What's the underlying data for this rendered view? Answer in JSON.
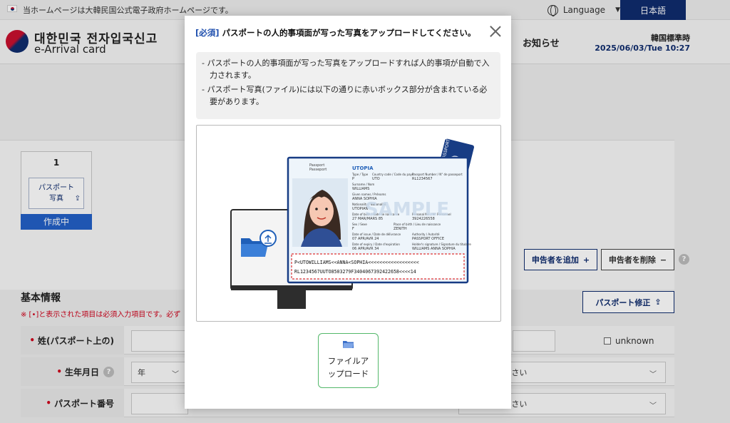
{
  "topbar": {
    "gov_notice": "当ホームページは大韓民国公式電子政府ホームページです。",
    "language_label": "Language",
    "current_language": "日本語"
  },
  "header": {
    "logo_korean": "대한민국 전자입국신고",
    "logo_english": "e-Arrival card",
    "nav_notice": "お知らせ",
    "time_label": "韓国標準時",
    "time_value": "2025/06/03/Tue 10:27"
  },
  "steps": [
    {
      "number": "1",
      "title_line1": "パスポート",
      "title_line2": "写真",
      "status": "作成中"
    }
  ],
  "actions": {
    "add_applicant": "申告者を追加",
    "add_symbol": "+",
    "remove_applicant": "申告者を削除",
    "remove_symbol": "−",
    "passport_edit": "パスポート修正",
    "help_symbol": "?"
  },
  "basic_info": {
    "title": "基本情報",
    "required_note": "※ [•]と表示された項目は必須入力項目です。必ず"
  },
  "form": {
    "star": "•",
    "surname_label": "姓(パスポート上の)",
    "unknown_label": "unknown",
    "birthdate_label": "生年月日",
    "year_placeholder": "年",
    "select_placeholder_1": "選択してください",
    "passport_number_label": "パスポート番号",
    "select_placeholder_2": "選択してください"
  },
  "modal": {
    "title_tag": "[必須]",
    "title_text": " パスポートの人的事項面が写った写真をアップロードしてください。",
    "notice_lines": [
      "- パスポートの人的事項面が写った写真をアップロードすれば人的事項が自動で入力されます。",
      "- パスポート写真(ファイル)には以下の通りに赤いボックス部分が含まれている必要があります。"
    ],
    "upload_label_line1": "ファイルア",
    "upload_label_line2": "ップロード"
  },
  "passport_sample": {
    "badge": "PASSPORT",
    "header_left_1": "Passport",
    "header_left_2": "Passeport",
    "country": "UTOPIA",
    "field_type_label": "Type / Type",
    "field_type_value": "P",
    "field_code_label": "Country code / Code du pays",
    "field_code_value": "UTO",
    "field_number_label": "Passport Number / N° de passeport",
    "field_number_value": "RL1234567",
    "surname_label": "Surname / Nom",
    "surname_value": "WILLIAMS",
    "given_label": "Given names / Prénoms",
    "given_value": "ANNA SOPHIA",
    "nationality_label": "Nationality / Nationalité",
    "nationality_value": "UTOPIAN",
    "dob_label": "Date of birth / Date de naissance",
    "dob_value": "27 MAR/MARS 85",
    "personal_label": "Personal No. / N° Personnel",
    "personal_value": "3924226558",
    "sex_label": "Sex / Sexe",
    "sex_value": "F",
    "pob_label": "Place of birth / Lieu de naissance",
    "pob_value": "ZENITH",
    "doi_label": "Date of issue / Date de délivrance",
    "doi_value": "07 APR/AVR 24",
    "authority_label": "Authority / Autorité",
    "authority_value": "PASSPORT OFFICE",
    "doe_label": "Date of expiry / Date d'expiration",
    "doe_value": "06 APR/AVR 34",
    "signature_label": "Holder's signature / Signature du titulaire",
    "signature_value": "WILLIAMS ANNA SOPHIA",
    "watermark": "SAMPLE",
    "mrz_line1": "P<UTOWILLIAMS<<ANNA<SOPHIA<<<<<<<<<<<<<<<<<<",
    "mrz_line2": "RL1234567UUTO8503279F3404067392422658<<<<14"
  },
  "colors": {
    "brand_navy": "#0f2c6e",
    "accent_blue": "#1f4fae",
    "status_blue": "#2360c7",
    "required_red": "#d0021b",
    "upload_green": "#53b86a"
  }
}
